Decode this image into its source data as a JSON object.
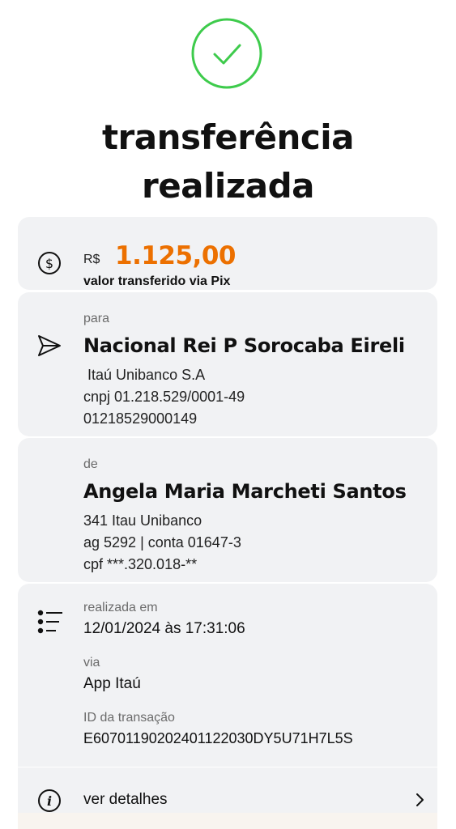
{
  "header": {
    "title_line1": "transferência",
    "title_line2": "realizada"
  },
  "amount": {
    "currency": "R$",
    "value": "1.125,00",
    "caption": "valor transferido via Pix",
    "icon": "dollar-circle-icon"
  },
  "recipient": {
    "label": "para",
    "name": "Nacional Rei P Sorocaba Eireli",
    "bank": " Itaú Unibanco S.A",
    "document": "cnpj 01.218.529/0001-49",
    "key": "01218529000149",
    "icon": "send-icon"
  },
  "sender": {
    "label": "de",
    "name": "Angela Maria Marcheti Santos",
    "bank": "341 Itau Unibanco",
    "account": "ag 5292 | conta 01647-3",
    "document": "cpf ***.320.018-**"
  },
  "info": {
    "icon": "list-icon",
    "date_label": "realizada em",
    "date_value": "12/01/2024 às 17:31:06",
    "via_label": "via",
    "via_value": "App Itaú",
    "id_label": "ID da transação",
    "id_value": "E60701190202401122030DY5U71H7L5S"
  },
  "details": {
    "label": "ver detalhes",
    "icon": "info-icon"
  },
  "colors": {
    "success": "#3ecb4c",
    "accent": "#ec7000",
    "card": "#f1f2f4"
  }
}
